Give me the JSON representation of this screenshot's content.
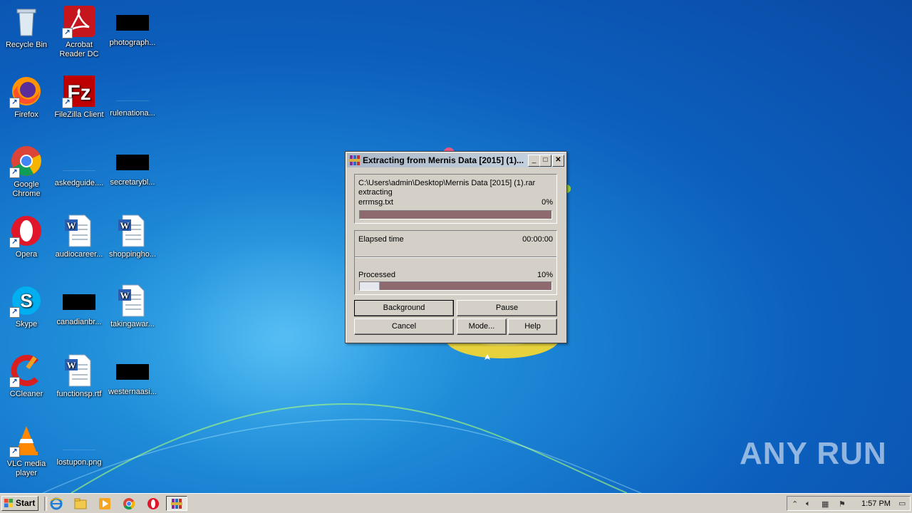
{
  "desktop": {
    "icons": [
      {
        "label": "Recycle Bin"
      },
      {
        "label": "Acrobat Reader DC"
      },
      {
        "label": "photograph..."
      },
      {
        "label": "Firefox"
      },
      {
        "label": "FileZilla Client"
      },
      {
        "label": "rulenationa..."
      },
      {
        "label": "Google Chrome"
      },
      {
        "label": "askedguide...."
      },
      {
        "label": "secretarybl..."
      },
      {
        "label": "Opera"
      },
      {
        "label": "audiocareer..."
      },
      {
        "label": "shoppingho..."
      },
      {
        "label": "Skype"
      },
      {
        "label": "canadianbr..."
      },
      {
        "label": "takingawar..."
      },
      {
        "label": "CCleaner"
      },
      {
        "label": "functionsp.rtf"
      },
      {
        "label": "westernaasi..."
      },
      {
        "label": "VLC media player"
      },
      {
        "label": "lostupon.png"
      }
    ]
  },
  "dialog": {
    "title": "Extracting from Mernis Data [2015] (1)...",
    "archive_path": "C:\\Users\\admin\\Desktop\\Mernis Data [2015] (1).rar",
    "action": "extracting",
    "current_file": "errmsg.txt",
    "file_percent_label": "0%",
    "file_progress": 0.0,
    "elapsed_label": "Elapsed time",
    "elapsed_value": "00:00:00",
    "processed_label": "Processed",
    "processed_percent_label": "10%",
    "processed_progress": 0.1,
    "buttons": {
      "background": "Background",
      "pause": "Pause",
      "cancel": "Cancel",
      "mode": "Mode...",
      "help": "Help"
    },
    "colors": {
      "progress_track": "#8e6a6e",
      "progress_fill": "#e6e6ee"
    }
  },
  "taskbar": {
    "start_label": "Start",
    "clock": "1:57 PM"
  },
  "watermark": "ANY RUN"
}
